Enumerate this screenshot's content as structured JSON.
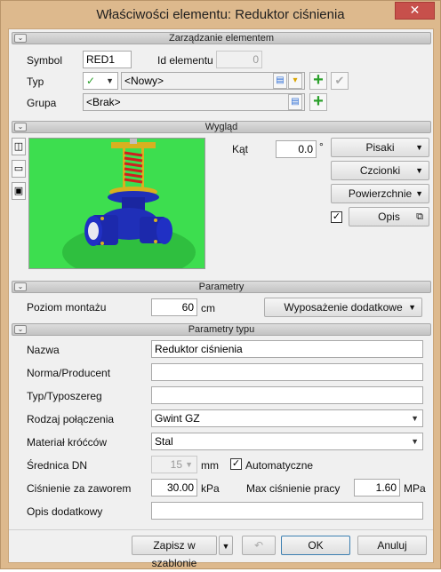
{
  "window": {
    "title": "Właściwości elementu: Reduktor ciśnienia",
    "close_label": "✕"
  },
  "sections": {
    "management": "Zarządzanie elementem",
    "appearance": "Wygląd",
    "parameters": "Parametry",
    "type_parameters": "Parametry typu"
  },
  "management": {
    "symbol_label": "Symbol",
    "symbol_value": "RED1",
    "id_label": "Id elementu",
    "id_value": "0",
    "type_label": "Typ",
    "type_value": "<Nowy>",
    "group_label": "Grupa",
    "group_value": "<Brak>"
  },
  "appearance": {
    "angle_label": "Kąt",
    "angle_value": "0.0",
    "angle_unit": "°",
    "pens_button": "Pisaki",
    "fonts_button": "Czcionki",
    "surfaces_button": "Powierzchnie",
    "description_label": "Opis",
    "description_checked": true
  },
  "parameters": {
    "mount_level_label": "Poziom montażu",
    "mount_level_value": "60",
    "mount_level_unit": "cm",
    "extra_equipment_button": "Wyposażenie dodatkowe"
  },
  "type_parameters": {
    "name_label": "Nazwa",
    "name_value": "Reduktor ciśnienia",
    "standard_label": "Norma/Producent",
    "standard_value": "",
    "series_label": "Typ/Typoszereg",
    "series_value": "",
    "connection_label": "Rodzaj połączenia",
    "connection_value": "Gwint GZ",
    "material_label": "Materiał króćców",
    "material_value": "Stal",
    "dn_label": "Średnica DN",
    "dn_value": "15",
    "dn_unit": "mm",
    "auto_label": "Automatyczne",
    "auto_checked": true,
    "pressure_after_label": "Ciśnienie za zaworem",
    "pressure_after_value": "30.00",
    "pressure_after_unit": "kPa",
    "max_pressure_label": "Max ciśnienie pracy",
    "max_pressure_value": "1.60",
    "max_pressure_unit": "MPa",
    "extra_desc_label": "Opis dodatkowy",
    "extra_desc_value": ""
  },
  "footer": {
    "save_template_button": "Zapisz w szablonie",
    "ok_button": "OK",
    "cancel_button": "Anuluj"
  },
  "colors": {
    "frame": "#ddb98d",
    "preview_bg": "#3dde4f",
    "valve_blue": "#1f2fb8",
    "add_green": "#2ca02c"
  }
}
